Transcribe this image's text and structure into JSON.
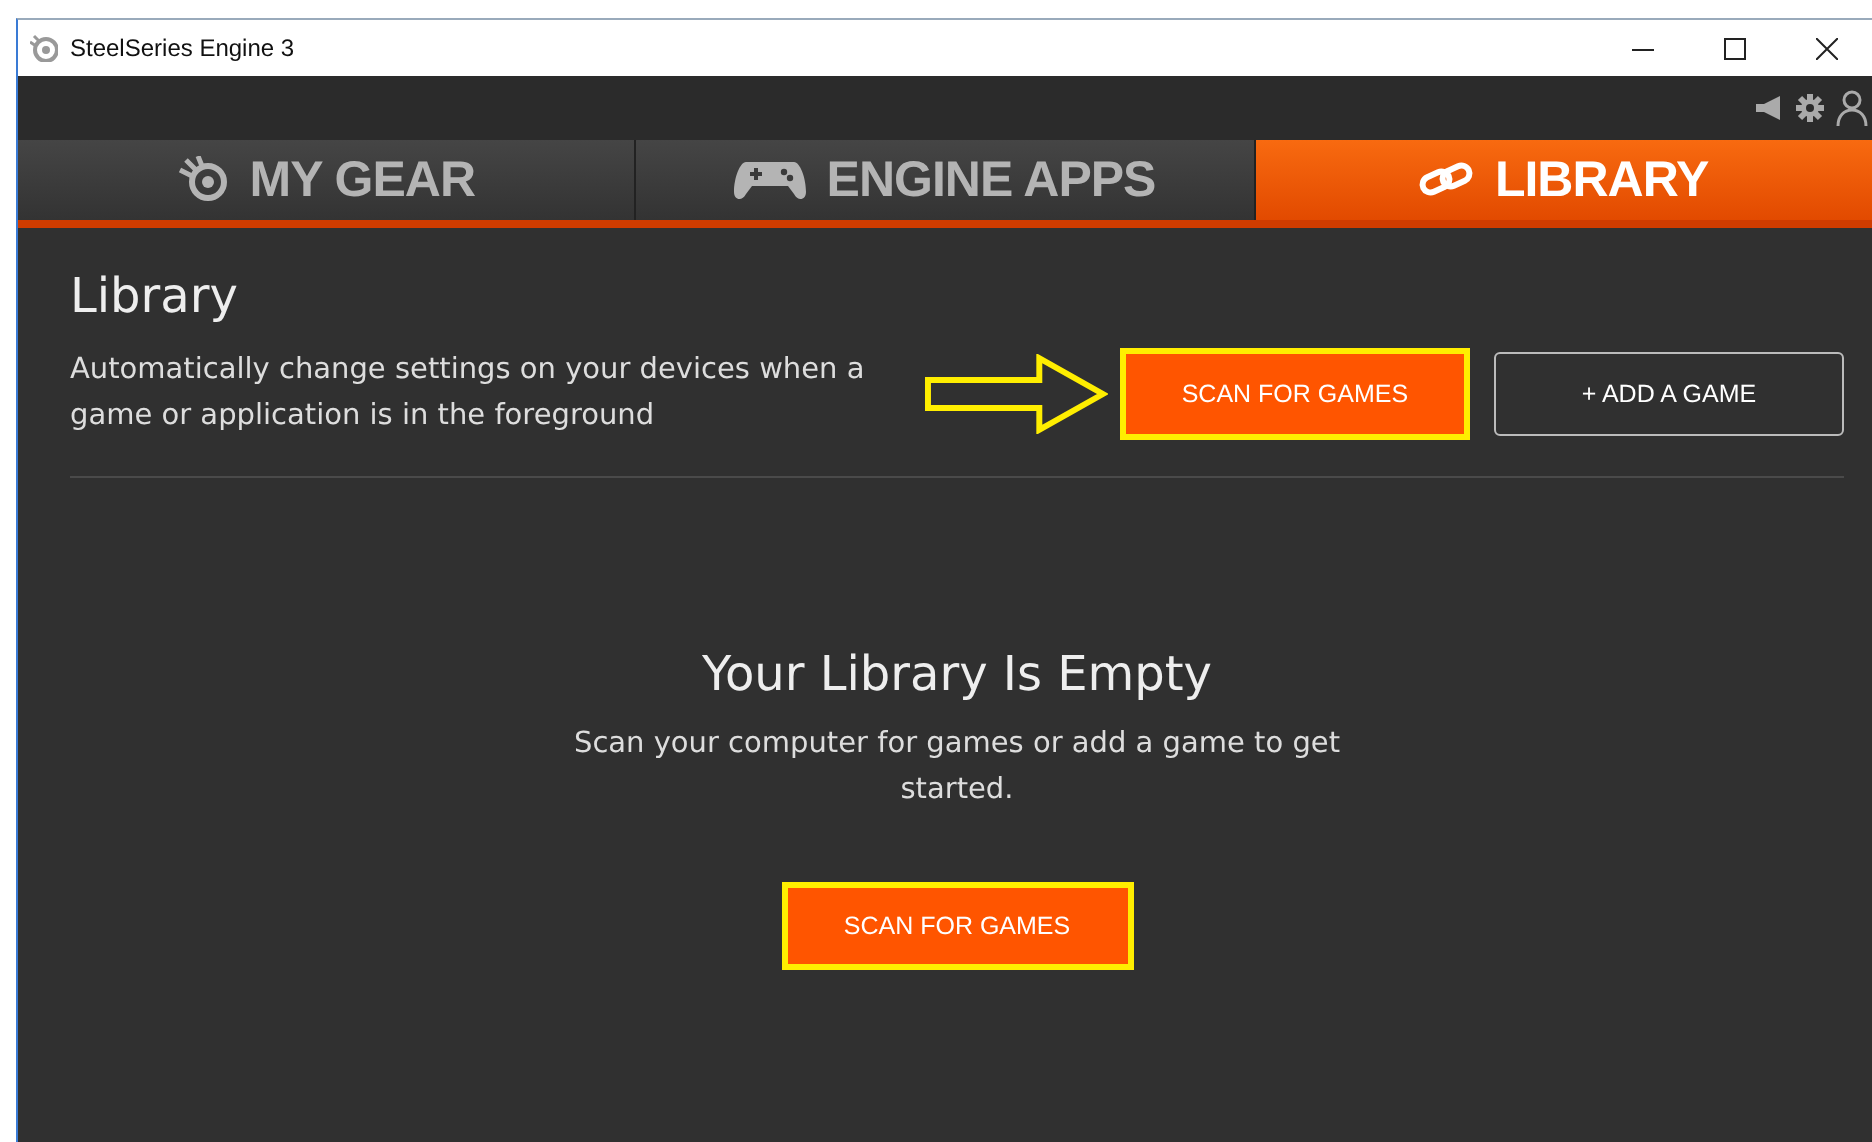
{
  "window": {
    "title": "SteelSeries Engine 3"
  },
  "tabs": [
    {
      "label": "MY GEAR",
      "selected": false
    },
    {
      "label": "ENGINE APPS",
      "selected": false
    },
    {
      "label": "LIBRARY",
      "selected": true
    }
  ],
  "library": {
    "title": "Library",
    "description": "Automatically change settings on your devices when a game or application is in the foreground",
    "buttons": [
      {
        "label": "SCAN FOR GAMES",
        "kind": "primary",
        "highlighted": true
      },
      {
        "label": "+ ADD A GAME",
        "kind": "outline",
        "highlighted": false
      }
    ]
  },
  "empty_state": {
    "title": "Your Library Is Empty",
    "message": "Scan your computer for games or add a game to get started.",
    "button": {
      "label": "SCAN FOR GAMES",
      "kind": "primary",
      "highlighted": true
    }
  }
}
